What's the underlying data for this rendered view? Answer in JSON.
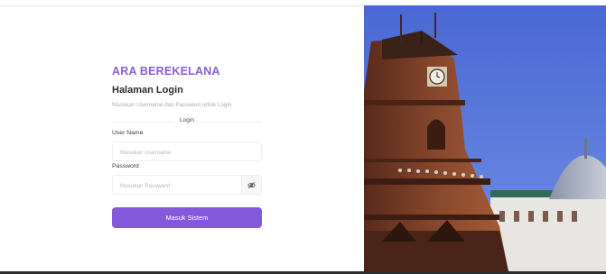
{
  "app": {
    "brand": "ARA BEREKELANA",
    "title": "Halaman Login",
    "subtitle": "Masukan Username dan Password untuk Login"
  },
  "form": {
    "section_label": "Login",
    "username": {
      "label": "User Name",
      "placeholder": "Masukan Username",
      "value": ""
    },
    "password": {
      "label": "Password",
      "placeholder": "Masukan Password",
      "value": ""
    },
    "submit_label": "Masuk Sistem"
  },
  "hero_image": {
    "icon": "eye-off-icon",
    "description_name": "minaret-tower-photo"
  },
  "colors": {
    "accent": "#8358db",
    "brand": "#8a5fd6",
    "sky": "#4f6fd8"
  }
}
